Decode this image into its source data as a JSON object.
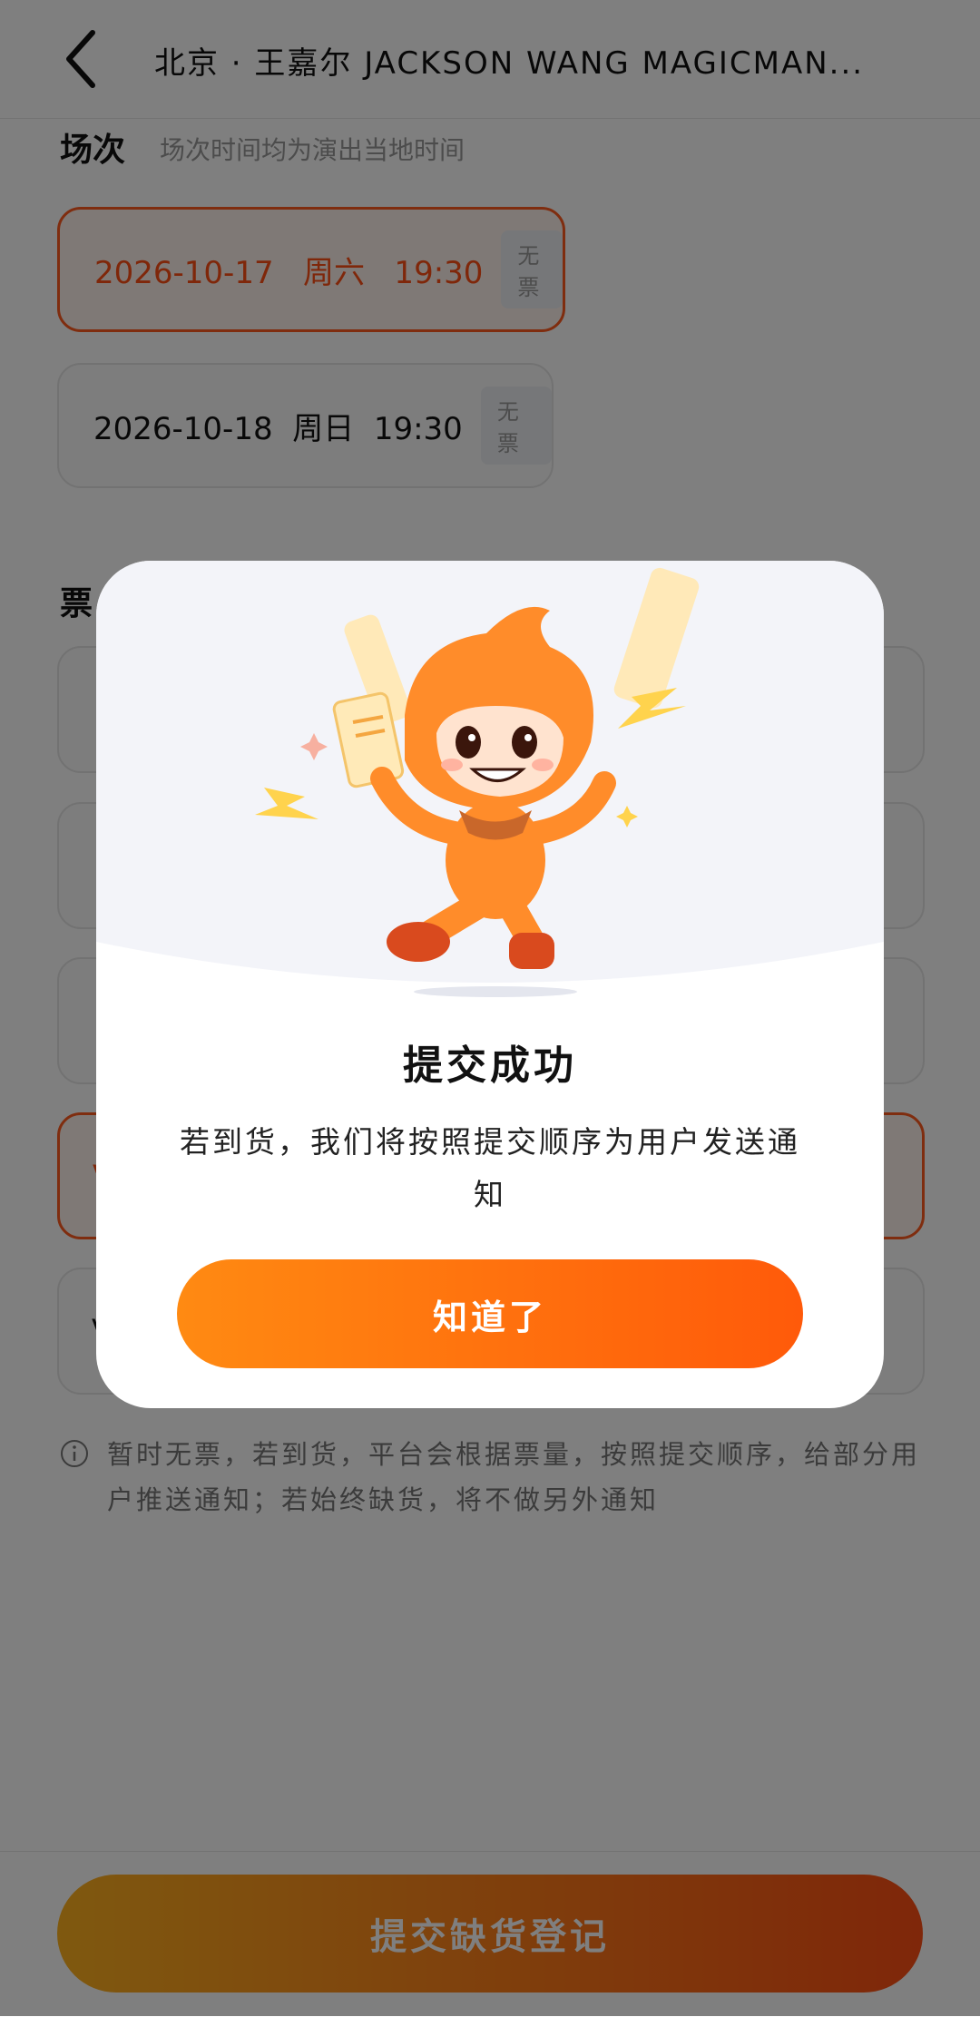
{
  "header": {
    "title": "北京 · 王嘉尔 JACKSON WANG MAGICMAN..."
  },
  "session_section": {
    "title": "场次",
    "subtitle": "场次时间均为演出当地时间",
    "items": [
      {
        "label": "2026-10-17   周六   19:30",
        "badge": "无票",
        "selected": true
      },
      {
        "label": "2026-10-18  周日  19:30",
        "badge": "无票",
        "selected": false
      }
    ]
  },
  "ticket_section": {
    "title": "票"
  },
  "ticket_items": [
    {
      "label": "",
      "selected": false
    },
    {
      "label": "",
      "selected": false
    },
    {
      "label": "",
      "selected": false
    },
    {
      "label": "V",
      "selected": true
    },
    {
      "label": "V",
      "selected": false
    }
  ],
  "note": "暂时无票，若到货，平台会根据票量，按照提交顺序，给部分用户推送通知；若始终缺货，将不做另外通知",
  "bottom": {
    "submit_label": "提交缺货登记"
  },
  "modal": {
    "title": "提交成功",
    "description": "若到货，我们将按照提交顺序为用户发送通知",
    "button_label": "知道了"
  },
  "colors": {
    "accent": "#ff5a1f",
    "button_start": "#ff8a12",
    "button_end": "#ff5a0a",
    "overlay": "rgba(0,0,0,0.5)"
  }
}
